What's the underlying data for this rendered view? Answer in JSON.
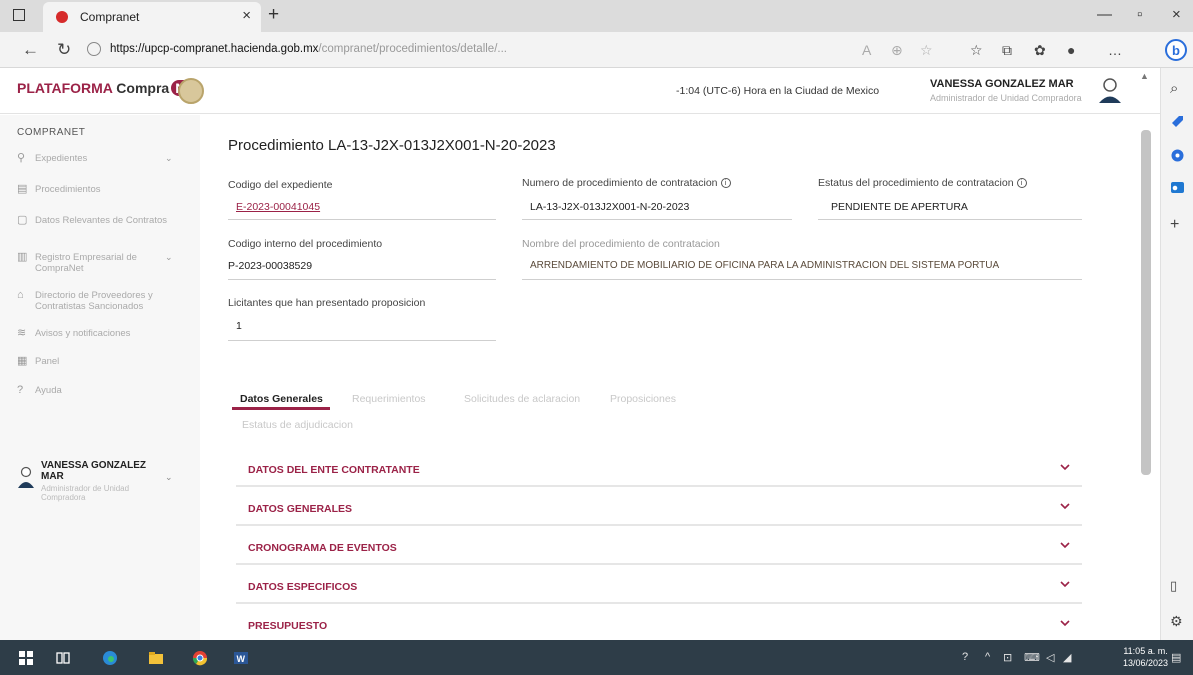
{
  "browser": {
    "tab_title": "Compranet",
    "url_host": "https://upcp-compranet.hacienda.gob.mx",
    "url_rest": "/compranet/procedimientos/detalle/..."
  },
  "header": {
    "logo_part1": "PLATAFORMA",
    "logo_part2": "Compra",
    "logo_part3": "Net",
    "timezone": "-1:04 (UTC-6) Hora en la Ciudad de Mexico",
    "user_name": "VANESSA GONZALEZ MAR",
    "user_role": "Administrador de Unidad Compradora"
  },
  "sidebar": {
    "title": "COMPRANET",
    "items": [
      {
        "icon": "folder-icon",
        "label": "Expedientes"
      },
      {
        "icon": "clipboard-icon",
        "label": "Procedimientos"
      },
      {
        "icon": "document-icon",
        "label": "Datos Relevantes de Contratos"
      },
      {
        "icon": "building-icon",
        "label": "Registro Empresarial de CompraNet"
      },
      {
        "icon": "bank-icon",
        "label": "Directorio de Proveedores y Contratistas Sancionados"
      },
      {
        "icon": "bell-icon",
        "label": "Avisos y notificaciones"
      },
      {
        "icon": "table-icon",
        "label": "Panel"
      },
      {
        "icon": "help-icon",
        "label": "Ayuda"
      }
    ],
    "user_name": "VANESSA GONZALEZ MAR",
    "user_role": "Administrador de Unidad Compradora"
  },
  "procedure": {
    "title": "Procedimiento LA-13-J2X-013J2X001-N-20-2023",
    "fields": {
      "expediente_label": "Codigo del expediente",
      "expediente_value": "E-2023-00041045",
      "numero_label": "Numero de procedimiento de contratacion",
      "numero_value": "LA-13-J2X-013J2X001-N-20-2023",
      "estatus_label": "Estatus del procedimiento de contratacion",
      "estatus_value": "PENDIENTE DE APERTURA",
      "interno_label": "Codigo interno del procedimiento",
      "interno_value": "P-2023-00038529",
      "nombre_label": "Nombre del procedimiento de contratacion",
      "nombre_value": "ARRENDAMIENTO DE MOBILIARIO DE OFICINA PARA LA ADMINISTRACION DEL SISTEMA PORTUA",
      "licitantes_label": "Licitantes que han presentado proposicion",
      "licitantes_value": "1"
    },
    "tabs": [
      "Datos Generales",
      "Requerimientos",
      "Solicitudes de aclaracion",
      "Proposiciones",
      "Estatus de adjudicacion"
    ],
    "accordions": [
      "DATOS DEL ENTE CONTRATANTE",
      "DATOS GENERALES",
      "CRONOGRAMA DE EVENTOS",
      "DATOS ESPECIFICOS",
      "PRESUPUESTO"
    ]
  },
  "taskbar": {
    "time": "11:05 a. m.",
    "date": "13/06/2023"
  },
  "colors": {
    "brand": "#9b2247",
    "sidebar_bg": "#f7f7f7",
    "taskbar_bg": "#2e3d48"
  }
}
